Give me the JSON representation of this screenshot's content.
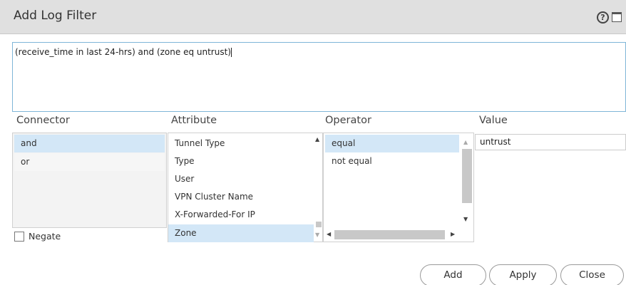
{
  "dialog": {
    "title": "Add Log Filter",
    "help_glyph": "?"
  },
  "filter": {
    "query": "(receive_time in last 24-hrs) and (zone eq untrust)"
  },
  "columns": {
    "connector": "Connector",
    "attribute": "Attribute",
    "operator": "Operator",
    "value": "Value"
  },
  "connector_list": {
    "items": [
      "and",
      "or"
    ],
    "selected": "and"
  },
  "attribute_list": {
    "items": [
      "Tunnel Type",
      "Type",
      "User",
      "VPN Cluster Name",
      "X-Forwarded-For IP",
      "Zone"
    ],
    "selected": "Zone"
  },
  "operator_list": {
    "items": [
      "equal",
      "not equal"
    ],
    "selected": "equal"
  },
  "value_field": {
    "value": "untrust"
  },
  "negate": {
    "label": "Negate",
    "checked": false
  },
  "buttons": {
    "add": "Add",
    "apply": "Apply",
    "close": "Close"
  },
  "colors": {
    "selection": "#d3e7f7",
    "accent_border": "#7fb6d8",
    "titlebar": "#e0e0e0"
  },
  "icons": [
    "help-icon",
    "maximize-icon"
  ]
}
